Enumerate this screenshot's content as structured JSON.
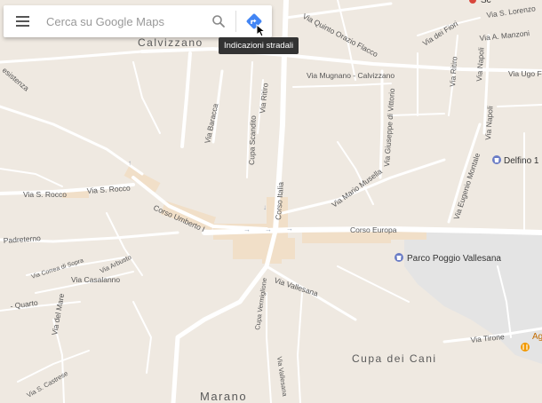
{
  "search": {
    "placeholder": "Cerca su Google Maps"
  },
  "tooltip": {
    "text": "Indicazioni stradali"
  },
  "icons": {
    "menu": "hamburger-menu-icon",
    "search": "search-icon",
    "directions": "directions-icon",
    "cursor": "mouse-cursor-icon"
  },
  "colors": {
    "land": "#efe9e1",
    "road": "#ffffff",
    "major_road": "#f4dfc4",
    "park": "#e4e4e4",
    "directions_blue": "#4285f4",
    "poi_pin": "#6b7dc6",
    "restaurant_pin": "#f29900"
  },
  "places": {
    "calvizzano": "Calvizzano",
    "marano": "Marano",
    "cupa_dei_cani": "Cupa dei Cani"
  },
  "pois": {
    "delfino": "Delfino 1",
    "parco": "Parco Poggio Vallesana",
    "agritu": "Agritu",
    "top_right_poi": "Sc"
  },
  "streets": {
    "s1": "Via Quinto Orazio Flacco",
    "s2": "Via S. Lorenzo",
    "s3": "Via dei Fiori",
    "s4": "Via A. Manzoni",
    "s5": "Via Ugo Fo",
    "s6": "Via Ritiro",
    "s7": "Via Napoli",
    "s8": "Via Napoli",
    "s9": "Via Mugnano - Calvizzano",
    "s10": "Via Giuseppe di Vittorio",
    "s11": "Via Mario Musella",
    "s12": "Via Eugenio Montale",
    "s13": "Via Baracca",
    "s14": "Cupa Scandito",
    "s15": "Via Ritiro",
    "s16": "Corso Italia",
    "s17": "Via S. Rocco",
    "s18": "Via S. Rocco",
    "s19": "Corso Umberto I",
    "s20": "Corso Europa",
    "s21": "Padreterno",
    "s22": "Via Correa di Sopra",
    "s23": "Via Arbusto",
    "s24": "Via Casalanno",
    "s25": "Via Vallesana",
    "s26": "Cupa Vermiglione",
    "s27": "Via del Mare",
    "s28": "Via Tirone",
    "s29": "Via S. Castrese",
    "s30": "Via Vallesana",
    "s31": "esistenza",
    "s32": "- Quarto"
  }
}
